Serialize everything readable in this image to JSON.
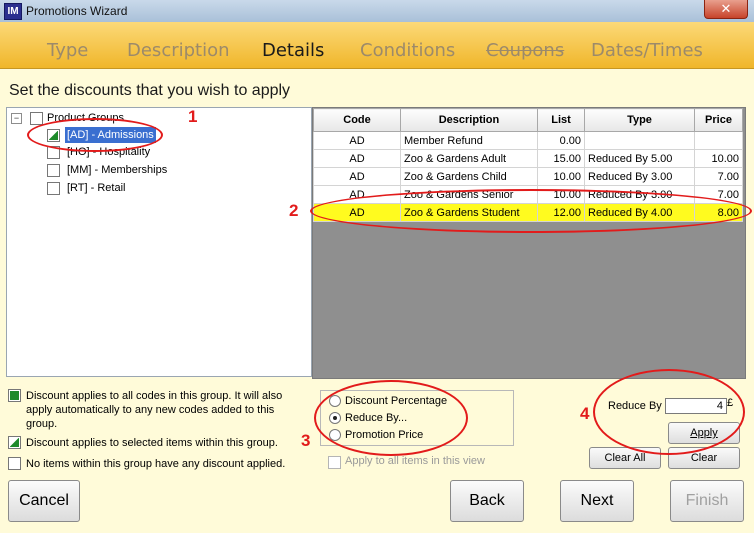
{
  "window": {
    "icon_text": "IM",
    "title": "Promotions Wizard",
    "close_label": "✕"
  },
  "tabs": [
    {
      "label": "Type"
    },
    {
      "label": "Description"
    },
    {
      "label": "Details"
    },
    {
      "label": "Conditions"
    },
    {
      "label": "Coupons"
    },
    {
      "label": "Dates/Times"
    }
  ],
  "heading": "Set the discounts that you wish to apply",
  "tree": {
    "root_expander": "−",
    "root_label": "Product Groups",
    "items": [
      {
        "label": "[AD] - Admissions",
        "state": "partial",
        "selected": true
      },
      {
        "label": "[HO] - Hospitality",
        "state": "none",
        "selected": false
      },
      {
        "label": "[MM] - Memberships",
        "state": "none",
        "selected": false
      },
      {
        "label": "[RT] - Retail",
        "state": "none",
        "selected": false
      }
    ]
  },
  "grid": {
    "headers": [
      "Code",
      "Description",
      "List",
      "Type",
      "Price"
    ],
    "rows": [
      {
        "code": "AD",
        "description": "Member Refund",
        "list": "0.00",
        "type": "",
        "price": ""
      },
      {
        "code": "AD",
        "description": "Zoo & Gardens Adult",
        "list": "15.00",
        "type": "Reduced By 5.00",
        "price": "10.00"
      },
      {
        "code": "AD",
        "description": "Zoo & Gardens Child",
        "list": "10.00",
        "type": "Reduced By 3.00",
        "price": "7.00"
      },
      {
        "code": "AD",
        "description": "Zoo & Gardens Senior",
        "list": "10.00",
        "type": "Reduced By 3.00",
        "price": "7.00"
      },
      {
        "code": "AD",
        "description": "Zoo & Gardens Student",
        "list": "12.00",
        "type": "Reduced By 4.00",
        "price": "8.00"
      }
    ]
  },
  "legend": {
    "full": "Discount applies to all codes in this group. It will also apply automatically to any new codes added to this group.",
    "partial": "Discount applies to selected items within this group.",
    "none": "No items within this group have any discount applied."
  },
  "discount_options": {
    "items": [
      {
        "label": "Discount Percentage",
        "selected": false
      },
      {
        "label": "Reduce By...",
        "selected": true
      },
      {
        "label": "Promotion Price",
        "selected": false
      }
    ],
    "apply_all_label": "Apply to all items in this view"
  },
  "reduce": {
    "label": "Reduce By",
    "value": "4",
    "currency": "£",
    "apply_label": "Apply",
    "clear_all_label": "Clear All",
    "clear_label": "Clear"
  },
  "footer": {
    "cancel_label": "Cancel",
    "back_label": "Back",
    "next_label": "Next",
    "finish_label": "Finish"
  },
  "annotations": {
    "color": "#e21b1b",
    "labels": [
      "1",
      "2",
      "3",
      "4"
    ]
  },
  "colors": {
    "tab_bar": "#f5c542",
    "content_bg": "#fffbd9",
    "highlight_row": "#fffb1f",
    "selected_node": "#3a6fd0",
    "group_check": "#1d8a2a"
  }
}
